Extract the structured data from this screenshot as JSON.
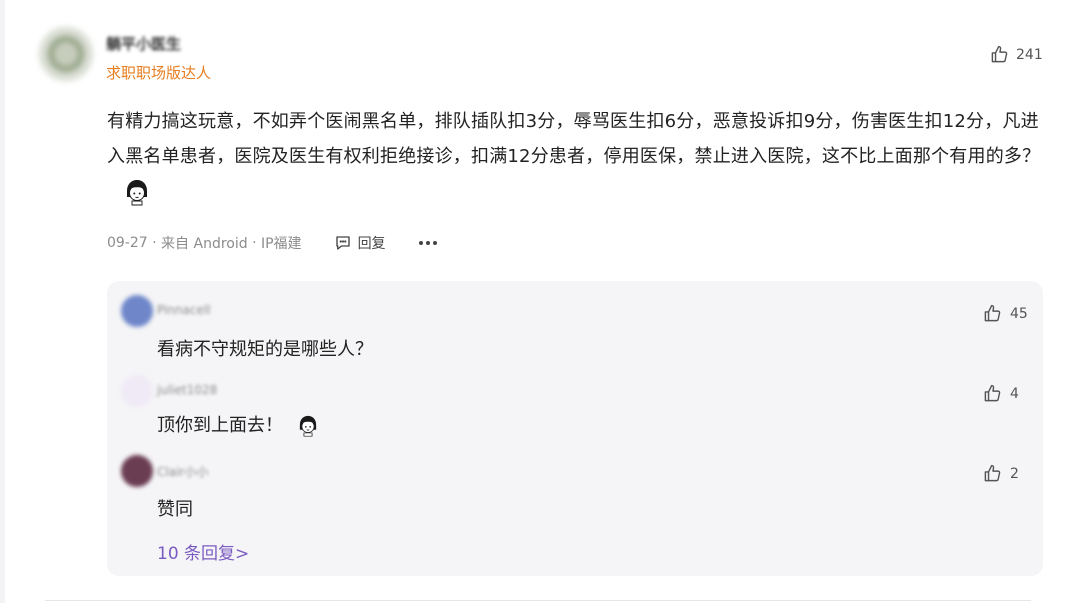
{
  "comment": {
    "username": "躺平小医生",
    "tag": "求职职场版达人",
    "like_count": "241",
    "text": "有精力搞这玩意，不如弄个医闹黑名单，排队插队扣3分，辱骂医生扣6分，恶意投诉扣9分，伤害医生扣12分，凡进入黑名单患者，医院及医生有权利拒绝接诊，扣满12分患者，停用医保，禁止进入医院，这不比上面那个有用的多？",
    "date": "09-27",
    "source": "来自 Android",
    "ip": "IP福建",
    "reply_label": "回复"
  },
  "replies": [
    {
      "name": "Pinnacell",
      "text": "看病不守规矩的是哪些人？",
      "likes": "45",
      "avatar_color": "#6f86c9"
    },
    {
      "name": "juliet1028",
      "text": "顶你到上面去！",
      "likes": "4",
      "avatar_color": "#efeaf6"
    },
    {
      "name": "Clair小小",
      "text": "赞同",
      "likes": "2",
      "avatar_color": "#6b3d52"
    }
  ],
  "more_replies_label": "10 条回复>",
  "icons": {
    "like": "thumbs-up-icon",
    "reply": "speech-bubble-icon",
    "more": "ellipsis-icon",
    "emoji": "girl-emoji-icon"
  },
  "colors": {
    "tag": "#e67e22",
    "link": "#7a5bc1",
    "reply_bg": "#f5f5f7"
  }
}
